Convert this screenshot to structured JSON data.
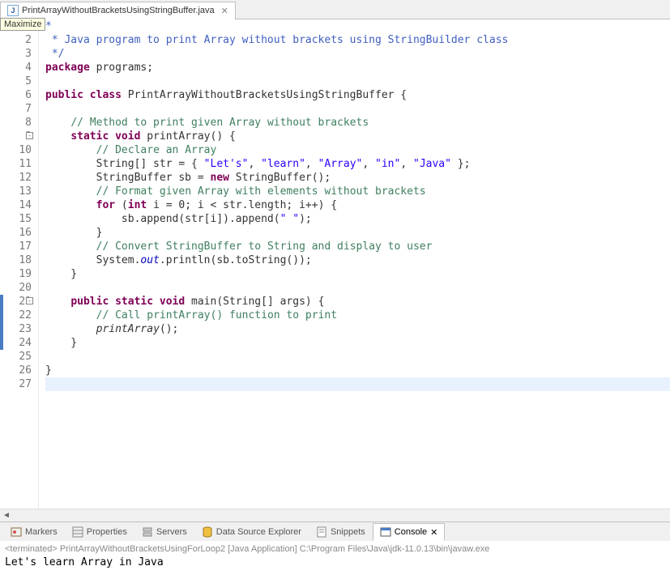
{
  "tab": {
    "filename": "PrintArrayWithoutBracketsUsingStringBuffer.java",
    "tooltip": "Maximize"
  },
  "code": {
    "lines": [
      {
        "n": "",
        "frag": [
          {
            "t": "*",
            "c": "jd"
          }
        ]
      },
      {
        "n": "2",
        "frag": [
          {
            "t": " * Java program to print Array without brackets using StringBuilder class",
            "c": "jd"
          }
        ]
      },
      {
        "n": "3",
        "frag": [
          {
            "t": " */",
            "c": "jd"
          }
        ]
      },
      {
        "n": "4",
        "frag": [
          {
            "t": "package",
            "c": "kw"
          },
          {
            "t": " programs;"
          }
        ]
      },
      {
        "n": "5",
        "frag": []
      },
      {
        "n": "6",
        "frag": [
          {
            "t": "public class",
            "c": "kw"
          },
          {
            "t": " PrintArrayWithoutBracketsUsingStringBuffer {"
          }
        ]
      },
      {
        "n": "7",
        "frag": []
      },
      {
        "n": "8",
        "frag": [
          {
            "t": "    "
          },
          {
            "t": "// Method to print given Array without brackets",
            "c": "cm"
          }
        ]
      },
      {
        "n": "9",
        "fold": true,
        "frag": [
          {
            "t": "    "
          },
          {
            "t": "static void",
            "c": "kw"
          },
          {
            "t": " printArray() {"
          }
        ]
      },
      {
        "n": "10",
        "frag": [
          {
            "t": "        "
          },
          {
            "t": "// Declare an Array",
            "c": "cm"
          }
        ]
      },
      {
        "n": "11",
        "frag": [
          {
            "t": "        String[] str = { "
          },
          {
            "t": "\"Let's\"",
            "c": "str"
          },
          {
            "t": ", "
          },
          {
            "t": "\"learn\"",
            "c": "str"
          },
          {
            "t": ", "
          },
          {
            "t": "\"Array\"",
            "c": "str"
          },
          {
            "t": ", "
          },
          {
            "t": "\"in\"",
            "c": "str"
          },
          {
            "t": ", "
          },
          {
            "t": "\"Java\"",
            "c": "str"
          },
          {
            "t": " };"
          }
        ]
      },
      {
        "n": "12",
        "frag": [
          {
            "t": "        StringBuffer sb = "
          },
          {
            "t": "new",
            "c": "kw"
          },
          {
            "t": " StringBuffer();"
          }
        ]
      },
      {
        "n": "13",
        "frag": [
          {
            "t": "        "
          },
          {
            "t": "// Format given Array with elements without brackets",
            "c": "cm"
          }
        ]
      },
      {
        "n": "14",
        "frag": [
          {
            "t": "        "
          },
          {
            "t": "for",
            "c": "kw"
          },
          {
            "t": " ("
          },
          {
            "t": "int",
            "c": "kw"
          },
          {
            "t": " i = 0; i < str.length; i++) {"
          }
        ]
      },
      {
        "n": "15",
        "frag": [
          {
            "t": "            sb.append(str[i]).append("
          },
          {
            "t": "\" \"",
            "c": "str"
          },
          {
            "t": ");"
          }
        ]
      },
      {
        "n": "16",
        "frag": [
          {
            "t": "        }"
          }
        ]
      },
      {
        "n": "17",
        "frag": [
          {
            "t": "        "
          },
          {
            "t": "// Convert StringBuffer to String and display to user",
            "c": "cm"
          }
        ]
      },
      {
        "n": "18",
        "frag": [
          {
            "t": "        System."
          },
          {
            "t": "out",
            "c": "fld"
          },
          {
            "t": ".println(sb.toString());"
          }
        ]
      },
      {
        "n": "19",
        "frag": [
          {
            "t": "    }"
          }
        ]
      },
      {
        "n": "20",
        "frag": []
      },
      {
        "n": "21",
        "fold": true,
        "change": true,
        "frag": [
          {
            "t": "    "
          },
          {
            "t": "public static void",
            "c": "kw"
          },
          {
            "t": " main(String[] args) {"
          }
        ]
      },
      {
        "n": "22",
        "change": true,
        "frag": [
          {
            "t": "        "
          },
          {
            "t": "// Call printArray() function to print",
            "c": "cm"
          }
        ]
      },
      {
        "n": "23",
        "change": true,
        "frag": [
          {
            "t": "        "
          },
          {
            "t": "printArray",
            "c": "mcall"
          },
          {
            "t": "();"
          }
        ]
      },
      {
        "n": "24",
        "change": true,
        "frag": [
          {
            "t": "    }"
          }
        ]
      },
      {
        "n": "25",
        "frag": []
      },
      {
        "n": "26",
        "frag": [
          {
            "t": "}"
          }
        ]
      },
      {
        "n": "27",
        "hl": true,
        "frag": []
      }
    ]
  },
  "bottomTabs": {
    "markers": "Markers",
    "properties": "Properties",
    "servers": "Servers",
    "dse": "Data Source Explorer",
    "snippets": "Snippets",
    "console": "Console"
  },
  "console": {
    "status": "<terminated> PrintArrayWithoutBracketsUsingForLoop2 [Java Application] C:\\Program Files\\Java\\jdk-11.0.13\\bin\\javaw.exe",
    "output": "Let's learn Array in Java"
  }
}
